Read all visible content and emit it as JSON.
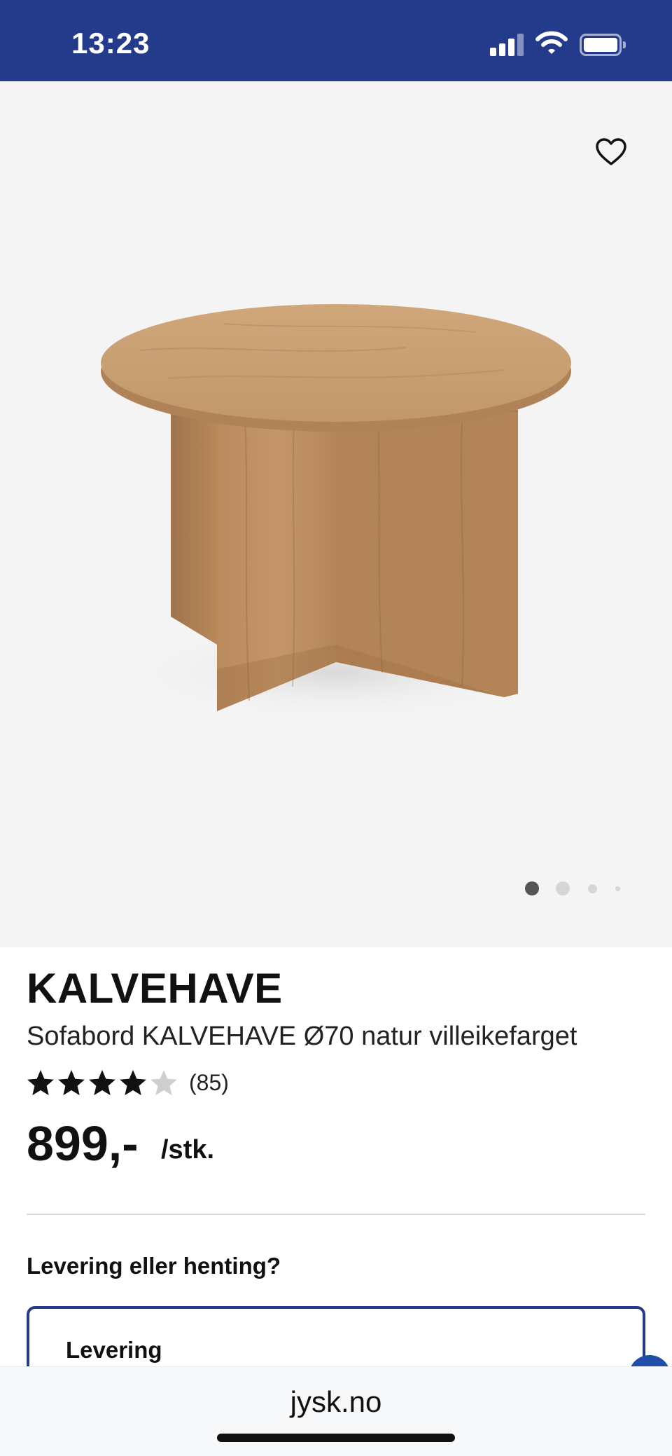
{
  "status_bar": {
    "time": "13:23",
    "signal_icon": "cellular-signal-icon",
    "wifi_icon": "wifi-icon",
    "battery_icon": "battery-icon",
    "background": "#243a8a"
  },
  "gallery": {
    "favorite_icon": "heart-outline-icon",
    "image_alt": "round oak coffee table",
    "image_count": 4,
    "active_index": 0
  },
  "product": {
    "brand": "KALVEHAVE",
    "name": "Sofabord KALVEHAVE Ø70 natur villeikefarget",
    "rating_value": 4.6,
    "rating_max": 5,
    "review_count": "(85)",
    "price": "899,-",
    "price_unit": "/stk."
  },
  "fulfillment": {
    "question": "Levering eller henting?",
    "option_label": "Levering",
    "accent": "#243a8a"
  },
  "browser": {
    "url": "jysk.no"
  }
}
